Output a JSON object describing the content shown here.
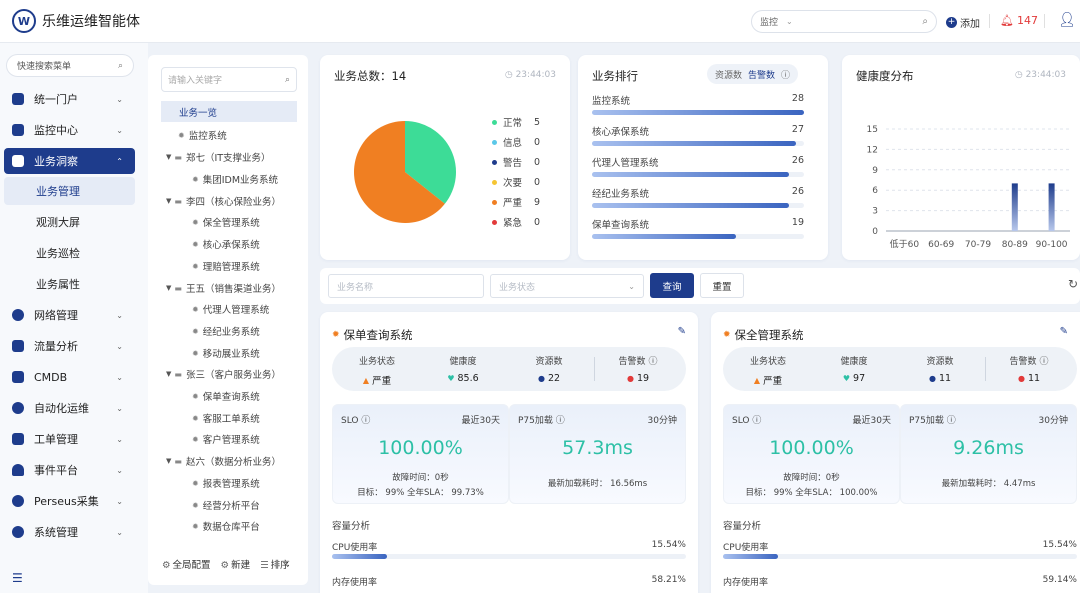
{
  "header": {
    "logo_letter": "W",
    "app_title": "乐维运维智能体",
    "search_scope": "监控",
    "add_label": "添加",
    "alert_count": "147"
  },
  "sidebar": {
    "search_placeholder": "快速搜索菜单",
    "items": [
      {
        "label": "统一门户",
        "icon": "portal-icon"
      },
      {
        "label": "监控中心",
        "icon": "monitor-icon"
      },
      {
        "label": "业务洞察",
        "icon": "insight-icon"
      },
      {
        "label": "网络管理",
        "icon": "globe-icon"
      },
      {
        "label": "流量分析",
        "icon": "traffic-icon"
      },
      {
        "label": "CMDB",
        "icon": "cube-icon"
      },
      {
        "label": "自动化运维",
        "icon": "gear-icon"
      },
      {
        "label": "工单管理",
        "icon": "ticket-icon"
      },
      {
        "label": "事件平台",
        "icon": "bell-icon"
      },
      {
        "label": "Perseus采集",
        "icon": "collect-icon"
      },
      {
        "label": "系统管理",
        "icon": "settings-icon"
      }
    ],
    "sub_items": [
      "业务管理",
      "观测大屏",
      "业务巡检",
      "业务属性"
    ]
  },
  "tree": {
    "search_placeholder": "请输入关键字",
    "nodes": {
      "root": "业务一览",
      "n1": "监控系统",
      "g1": "郑七（IT支撑业务）",
      "g1c1": "集团IDM业务系统",
      "g2": "李四（核心保险业务）",
      "g2c1": "保全管理系统",
      "g2c2": "核心承保系统",
      "g2c3": "理赔管理系统",
      "g3": "王五（销售渠道业务）",
      "g3c1": "代理人管理系统",
      "g3c2": "经纪业务系统",
      "g3c3": "移动展业系统",
      "g4": "张三（客户服务业务）",
      "g4c1": "保单查询系统",
      "g4c2": "客服工单系统",
      "g4c3": "客户管理系统",
      "g5": "赵六（数据分析业务）",
      "g5c1": "报表管理系统",
      "g5c2": "经营分析平台",
      "g5c3": "数据仓库平台"
    },
    "footer": {
      "global": "全局配置",
      "new": "新建",
      "sort": "排序"
    }
  },
  "total_card": {
    "title": "业务总数：14",
    "time": "23:44:03",
    "legend": [
      {
        "label": "正常",
        "value": "5",
        "color": "#3ddc97"
      },
      {
        "label": "信息",
        "value": "0",
        "color": "#5bc8e8"
      },
      {
        "label": "警告",
        "value": "0",
        "color": "#1e3c8c"
      },
      {
        "label": "次要",
        "value": "0",
        "color": "#f5c533"
      },
      {
        "label": "严重",
        "value": "9",
        "color": "#f07f22"
      },
      {
        "label": "紧急",
        "value": "0",
        "color": "#e23a3a"
      }
    ]
  },
  "rank_card": {
    "title": "业务排行",
    "toggle_a": "资源数",
    "toggle_b": "告警数",
    "rows": [
      {
        "name": "监控系统",
        "value": "28",
        "fraction": 1.0
      },
      {
        "name": "核心承保系统",
        "value": "27",
        "fraction": 0.96
      },
      {
        "name": "代理人管理系统",
        "value": "26",
        "fraction": 0.93
      },
      {
        "name": "经纪业务系统",
        "value": "26",
        "fraction": 0.93
      },
      {
        "name": "保单查询系统",
        "value": "19",
        "fraction": 0.68
      }
    ]
  },
  "health_card": {
    "title": "健康度分布",
    "time": "23:44:03"
  },
  "chart_data": {
    "type": "bar",
    "categories": [
      "低于60",
      "60-69",
      "70-79",
      "80-89",
      "90-100"
    ],
    "values": [
      0,
      0,
      0,
      7,
      7
    ],
    "y_ticks": [
      "0",
      "3",
      "6",
      "9",
      "12",
      "15"
    ],
    "ylim": [
      0,
      15
    ],
    "grid": true
  },
  "filter": {
    "name_placeholder": "业务名称",
    "status_placeholder": "业务状态",
    "query_label": "查询",
    "reset_label": "重置"
  },
  "services": [
    {
      "title": "保单查询系统",
      "stats": {
        "status_label": "业务状态",
        "status": "严重",
        "health_label": "健康度",
        "health": "85.6",
        "res_label": "资源数",
        "res": "22",
        "alert_label": "告警数",
        "alert": "19"
      },
      "slo": {
        "title": "SLO",
        "period": "最近30天",
        "value": "100.00%",
        "downtime": "故障时间：0秒",
        "target": "目标：  99%   全年SLA：  99.73%"
      },
      "p75": {
        "title": "P75加载",
        "period": "30分钟",
        "value": "57.3ms",
        "latest": "最新加载耗时：  16.56ms"
      },
      "capacity_title": "容量分析",
      "cpu": {
        "label": "CPU使用率",
        "value": "15.54%",
        "fraction": 0.1554
      },
      "mem": {
        "label": "内存使用率",
        "value": "58.21%",
        "fraction": 0.5821
      }
    },
    {
      "title": "保全管理系统",
      "stats": {
        "status_label": "业务状态",
        "status": "严重",
        "health_label": "健康度",
        "health": "97",
        "res_label": "资源数",
        "res": "11",
        "alert_label": "告警数",
        "alert": "11"
      },
      "slo": {
        "title": "SLO",
        "period": "最近30天",
        "value": "100.00%",
        "downtime": "故障时间：0秒",
        "target": "目标：  99%   全年SLA：  100.00%"
      },
      "p75": {
        "title": "P75加载",
        "period": "30分钟",
        "value": "9.26ms",
        "latest": "最新加载耗时：  4.47ms"
      },
      "capacity_title": "容量分析",
      "cpu": {
        "label": "CPU使用率",
        "value": "15.54%",
        "fraction": 0.1554
      },
      "mem": {
        "label": "内存使用率",
        "value": "59.14%",
        "fraction": 0.5914
      }
    }
  ]
}
